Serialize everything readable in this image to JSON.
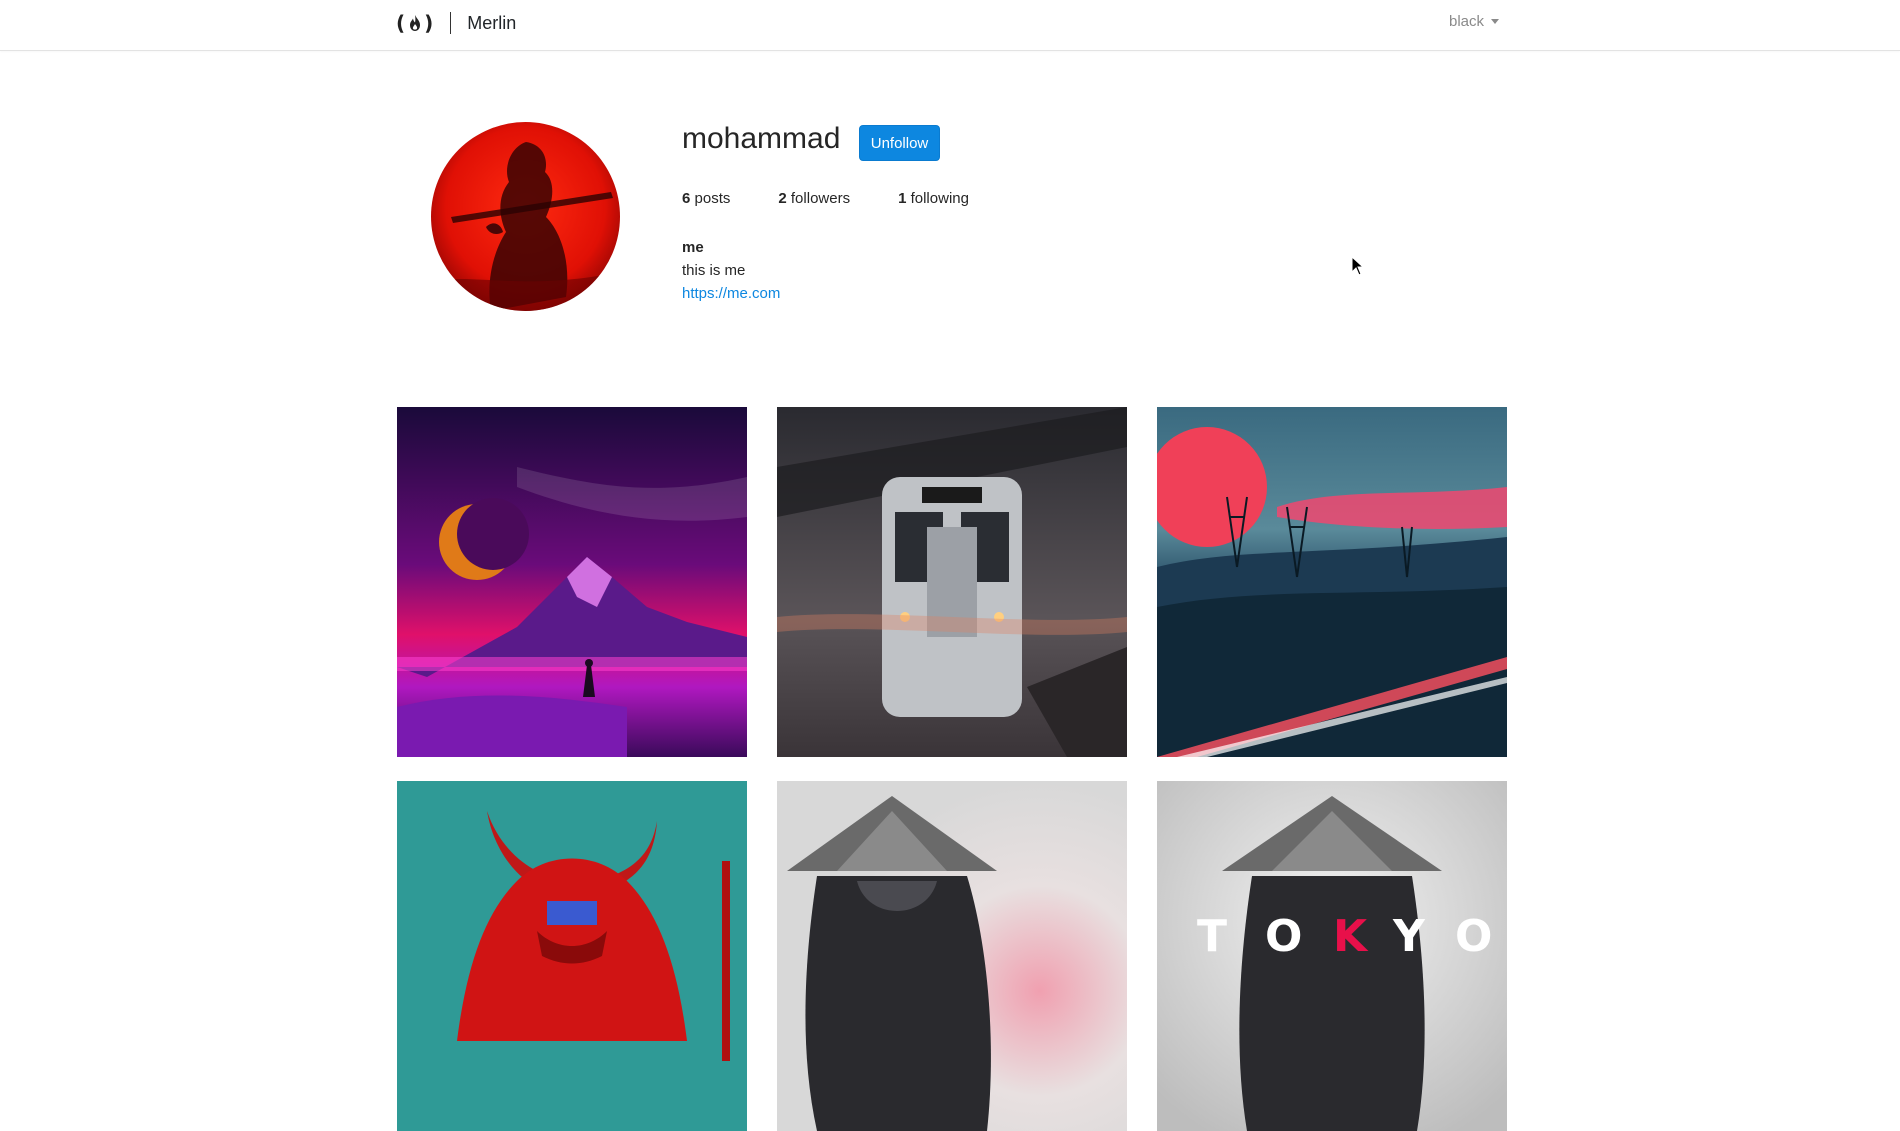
{
  "navbar": {
    "brand_name": "Merlin",
    "logo_left": "(",
    "logo_right": ")",
    "user_menu_label": "black"
  },
  "profile": {
    "username": "mohammad",
    "follow_button_label": "Unfollow",
    "stats": {
      "posts_count": "6",
      "posts_label": "posts",
      "followers_count": "2",
      "followers_label": "followers",
      "following_count": "1",
      "following_label": "following"
    },
    "bio": {
      "name": "me",
      "text": "this is me",
      "link": "https://me.com"
    }
  },
  "posts": [
    {
      "subject": "purple mountain with crescent moon and lone figure"
    },
    {
      "subject": "commuter train at station in rain"
    },
    {
      "subject": "red sunset with power lines and highway light trails"
    },
    {
      "subject": "red oni samurai mask on teal background"
    },
    {
      "subject": "samurai with straw hat in grey mist"
    },
    {
      "subject": "samurai with straw hat and TOKYO lettering"
    }
  ],
  "colors": {
    "accent": "#0d87e0",
    "text": "#262626",
    "muted": "#8a8a8a"
  }
}
